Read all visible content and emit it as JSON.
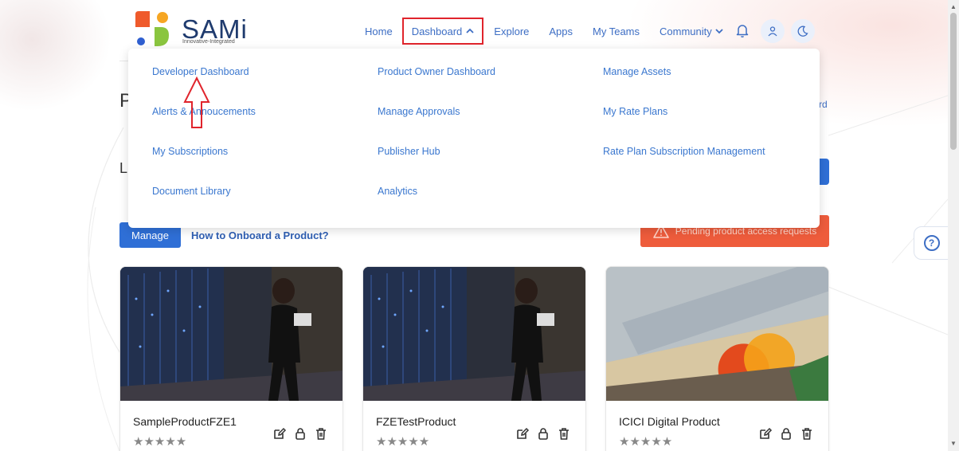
{
  "brand": {
    "name": "SAMi",
    "tagline": "Innovative-Integrated"
  },
  "nav": {
    "home": "Home",
    "dashboard": "Dashboard",
    "explore": "Explore",
    "apps": "Apps",
    "my_teams": "My Teams",
    "community": "Community"
  },
  "header_icons": [
    "bell-icon",
    "user-icon",
    "moon-icon"
  ],
  "dropdown": {
    "col1": [
      "Developer Dashboard",
      "Alerts & Annoucements",
      "My Subscriptions",
      "Document Library"
    ],
    "col2": [
      "Product Owner Dashboard",
      "Manage Approvals",
      "Publisher Hub",
      "Analytics"
    ],
    "col3": [
      "Manage Assets",
      "My Rate Plans",
      "Rate Plan Subscription Management"
    ]
  },
  "page": {
    "title_partial": "P",
    "label_partial": "L",
    "right_partial": "rd",
    "manage_label": "Manage",
    "onboard_link": "How to Onboard a Product?",
    "pending_label": "Pending product access requests",
    "help_symbol": "?"
  },
  "products": [
    {
      "title": "SampleProductFZE1",
      "rating": 0,
      "stars": "★★★★★"
    },
    {
      "title": "FZETestProduct",
      "rating": 0,
      "stars": "★★★★★"
    },
    {
      "title": "ICICI Digital Product",
      "rating": 0,
      "stars": "★★★★★"
    }
  ],
  "colors": {
    "accent": "#2f6fd6",
    "link": "#3a77cf",
    "warning": "#ee5c3c",
    "highlight": "#e0242c",
    "brand_dark": "#1f3b6e"
  }
}
